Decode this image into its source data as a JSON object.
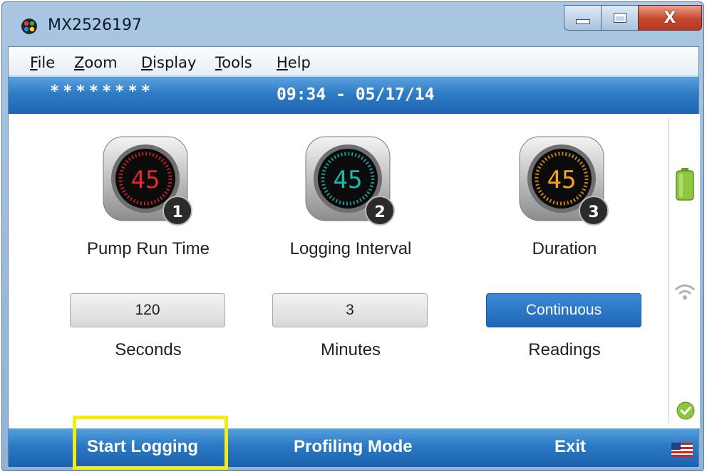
{
  "window": {
    "title": "MX2526197",
    "close_symbol": "X"
  },
  "menu": [
    {
      "label": "File",
      "mnemonic": "F",
      "rest": "ile"
    },
    {
      "label": "Zoom",
      "mnemonic": "Z",
      "rest": "oom"
    },
    {
      "label": "Display",
      "mnemonic": "D",
      "rest": "isplay"
    },
    {
      "label": "Tools",
      "mnemonic": "T",
      "rest": "ools"
    },
    {
      "label": "Help",
      "mnemonic": "H",
      "rest": "elp"
    }
  ],
  "status": {
    "password_mask": "********",
    "datetime": "09:34 - 05/17/14"
  },
  "parameters": [
    {
      "gauge_value": "45",
      "badge": "1",
      "label": "Pump Run Time",
      "value": "120",
      "unit": "Seconds",
      "color": "#e0282e",
      "active": false
    },
    {
      "gauge_value": "45",
      "badge": "2",
      "label": "Logging Interval",
      "value": "3",
      "unit": "Minutes",
      "color": "#1fb7a9",
      "active": false
    },
    {
      "gauge_value": "45",
      "badge": "3",
      "label": "Duration",
      "value": "Continuous",
      "unit": "Readings",
      "color": "#f4a21c",
      "active": true
    }
  ],
  "side_icons": [
    "battery-full-icon",
    "wifi-signal-icon",
    "check-ok-icon"
  ],
  "actions": {
    "start": "Start Logging",
    "profiling": "Profiling Mode",
    "exit": "Exit"
  },
  "colors": {
    "accent_blue": "#2b79c5",
    "highlight": "#f3ee12",
    "battery": "#8dc63f"
  }
}
